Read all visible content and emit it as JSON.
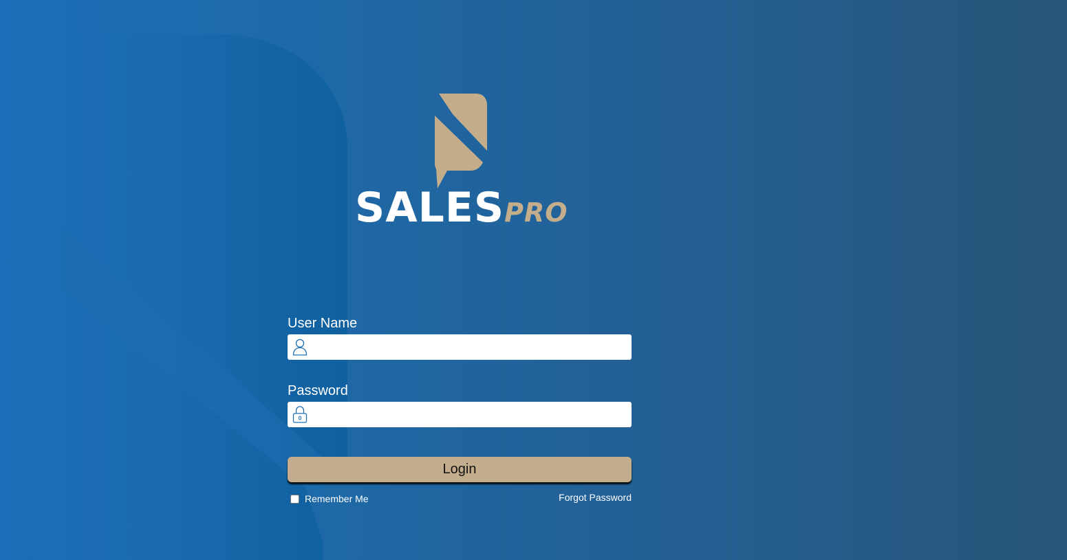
{
  "brand": {
    "name_primary": "SALES",
    "name_secondary": "PRO",
    "primary_color": "#ffffff",
    "accent_color": "#c4ad8b",
    "background_color": "#1f67a4"
  },
  "login_form": {
    "username": {
      "label": "User Name",
      "value": "",
      "icon": "user-icon"
    },
    "password": {
      "label": "Password",
      "value": "",
      "icon": "lock-icon"
    },
    "submit_label": "Login",
    "remember_me": {
      "label": "Remember Me",
      "checked": false
    },
    "forgot_password_label": "Forgot Password"
  }
}
